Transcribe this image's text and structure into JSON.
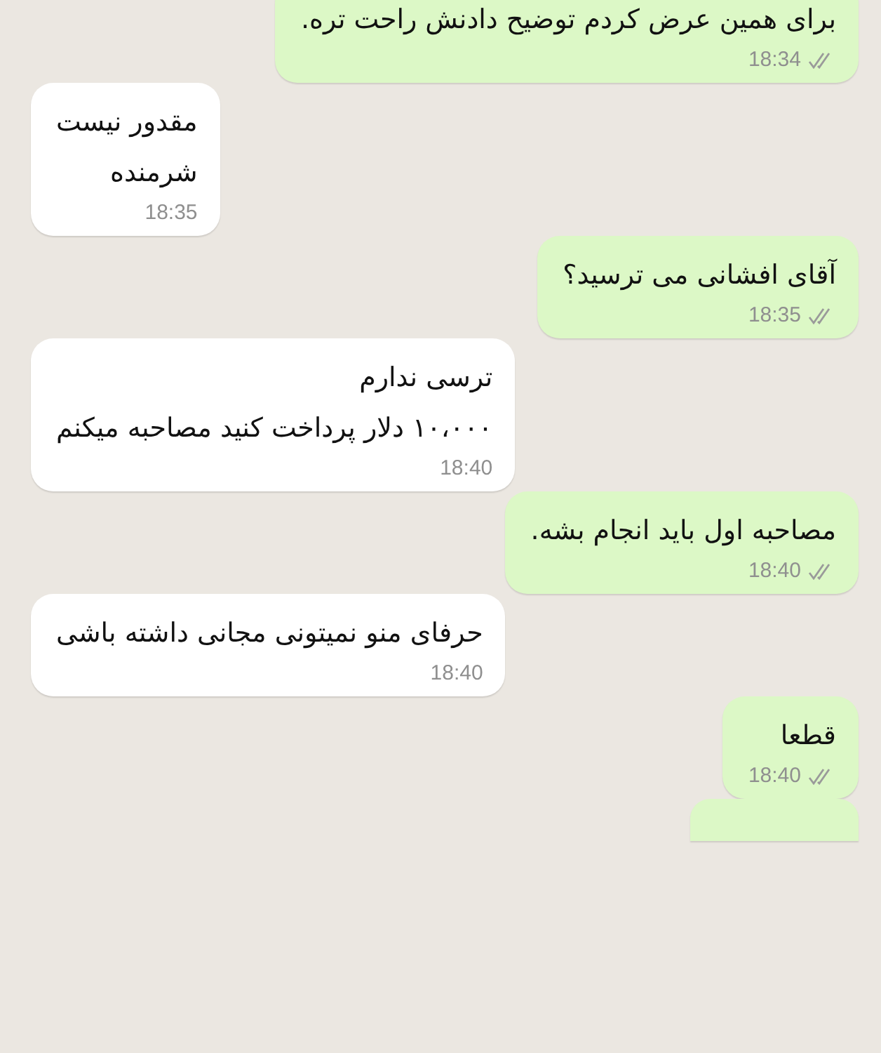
{
  "messages": [
    {
      "outgoing": true,
      "lines": [
        "برای همین عرض کردم توضیح دادنش راحت تره."
      ],
      "time": "18:34",
      "read": false
    },
    {
      "outgoing": false,
      "lines": [
        "مقدور نیست",
        "شرمنده"
      ],
      "time": "18:35"
    },
    {
      "outgoing": true,
      "lines": [
        "آقای افشانی می ترسید؟"
      ],
      "time": "18:35",
      "read": false
    },
    {
      "outgoing": false,
      "lines": [
        "ترسی ندارم",
        "۱۰،۰۰۰ دلار پرداخت کنید مصاحبه میکنم"
      ],
      "time": "18:40"
    },
    {
      "outgoing": true,
      "lines": [
        "مصاحبه اول باید انجام بشه."
      ],
      "time": "18:40",
      "read": false
    },
    {
      "outgoing": false,
      "lines": [
        "حرفای منو نمیتونی مجانی داشته باشی"
      ],
      "time": "18:40"
    },
    {
      "outgoing": true,
      "lines": [
        "قطعا"
      ],
      "time": "18:40",
      "read": false
    },
    {
      "outgoing": true,
      "kind": "partial"
    }
  ]
}
